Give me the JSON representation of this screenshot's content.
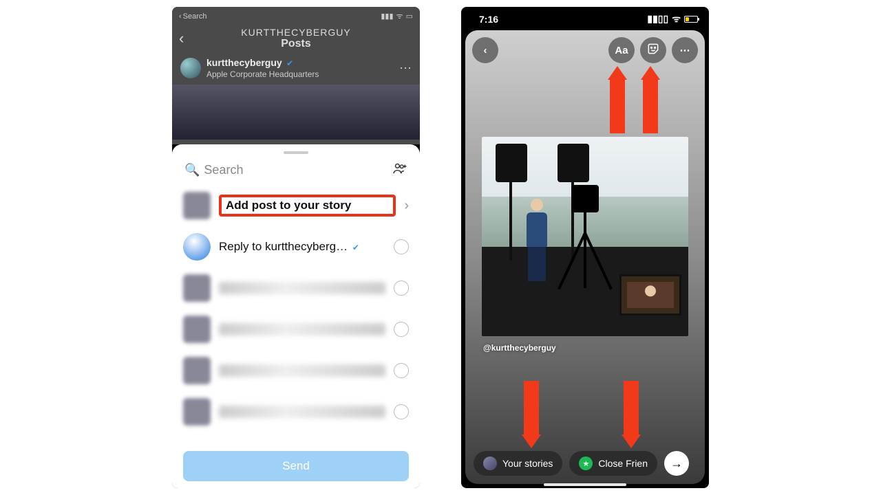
{
  "left": {
    "status": {
      "back_search": "Search"
    },
    "nav": {
      "username": "KURTTHECYBERGUY",
      "title": "Posts"
    },
    "post": {
      "author": "kurtthecyberguy",
      "location": "Apple Corporate Headquarters"
    },
    "sheet": {
      "search_placeholder": "Search",
      "add_story": "Add post to your story",
      "reply_to": "Reply to kurtthecyberg…",
      "send": "Send"
    }
  },
  "right": {
    "status": {
      "time": "7:16"
    },
    "toolbar": {
      "text_label": "Aa"
    },
    "handle": "@kurtthecyberguy",
    "bottom": {
      "your_stories": "Your stories",
      "close_friends": "Close Frien",
      "close_friends_full": "Close Friends"
    }
  },
  "annotations": {
    "arrows": [
      "text-tool",
      "sticker-tool",
      "your-stories",
      "close-friends"
    ]
  }
}
